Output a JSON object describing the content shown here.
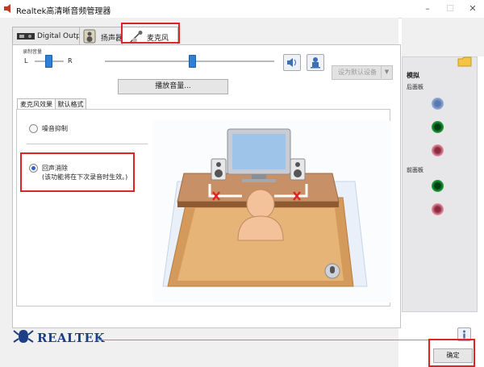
{
  "window": {
    "title": "Realtek高清晰音频管理器",
    "controls": [
      "–",
      "☐",
      "✕"
    ]
  },
  "tabs": [
    {
      "label": "Digital Output"
    },
    {
      "label": "扬声器"
    },
    {
      "label": "麦克风"
    }
  ],
  "volume": {
    "label": "录制音量",
    "left": "L",
    "right": "R",
    "balance": 0.5,
    "level": 0.78
  },
  "default_device": "设为默认设备",
  "playback_volume_button": "播放音量...",
  "subtabs": [
    "麦克风效果",
    "默认格式"
  ],
  "options": {
    "noise_suppression": "噪音抑制",
    "echo_cancellation": "回声消除",
    "echo_note": "(该功能将在下次录音时生效。)"
  },
  "right_panel": {
    "title": "模拟",
    "rear": "后面板",
    "front": "前面板"
  },
  "brand": "REALTEK",
  "ok_button": "确定",
  "colors": {
    "accent": "#2f7fd6",
    "highlight": "#e02424",
    "brand": "#1d3f86"
  }
}
